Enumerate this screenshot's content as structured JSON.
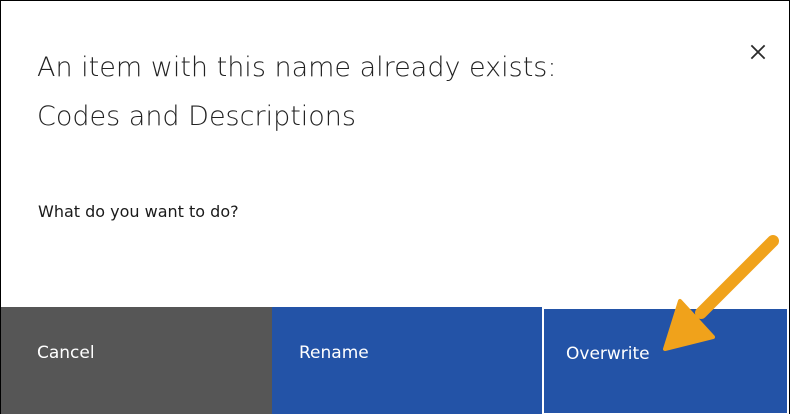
{
  "dialog": {
    "title_line1": "An item with this name already exists:",
    "title_line2": "Codes and Descriptions",
    "message": "What do you want to do?",
    "close_icon": "close-icon"
  },
  "buttons": {
    "cancel_label": "Cancel",
    "rename_label": "Rename",
    "overwrite_label": "Overwrite"
  },
  "colors": {
    "cancel_bg": "#565656",
    "primary_bg": "#2353a7",
    "annotation_arrow": "#f0a21b"
  }
}
